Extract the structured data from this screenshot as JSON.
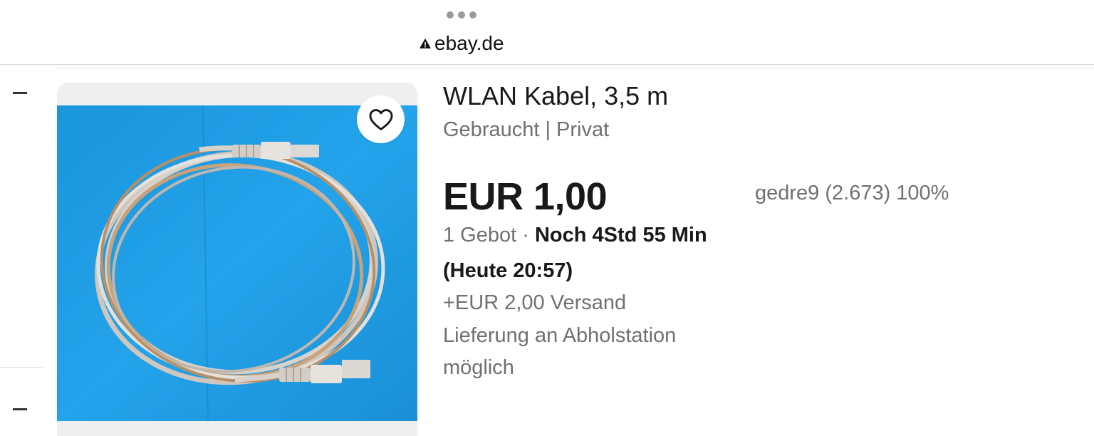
{
  "browser": {
    "url": "ebay.de",
    "url_icon": "warning-triangle-icon"
  },
  "listing": {
    "title": "WLAN Kabel, 3,5 m",
    "condition": "Gebraucht | Privat",
    "price": "EUR 1,00",
    "seller": "gedre9 (2.673) 100%",
    "bids": "1 Gebot",
    "separator": "·",
    "time_left": "Noch 4Std 55 Min",
    "end_time": "(Heute 20:57)",
    "shipping": "+EUR 2,00 Versand",
    "pickup_line1": "Lieferung an Abholstation",
    "pickup_line2": "möglich",
    "watch_icon": "heart-icon",
    "image_alt": "network-cable-photo"
  },
  "colors": {
    "image_background": "#1f9be0",
    "text_primary": "#191919",
    "text_secondary": "#707070"
  }
}
